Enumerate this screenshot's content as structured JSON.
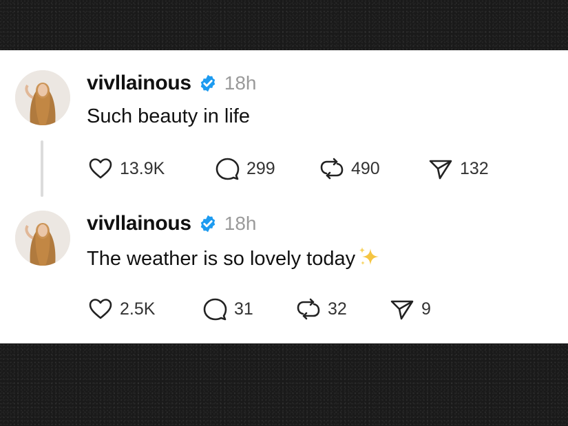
{
  "colors": {
    "verified_badge": "#1d9bf0",
    "timestamp": "#9a9a9a",
    "text": "#111111",
    "sparkle": "#f5c542"
  },
  "posts": [
    {
      "username": "vivllainous",
      "time": "18h",
      "text": "Such beauty in life",
      "emoji": "",
      "likes": "13.9K",
      "replies": "299",
      "reposts": "490",
      "shares": "132"
    },
    {
      "username": "vivllainous",
      "time": "18h",
      "text": "The weather is so lovely today",
      "emoji": "sparkles-icon",
      "likes": "2.5K",
      "replies": "31",
      "reposts": "32",
      "shares": "9"
    }
  ],
  "icons": {
    "like": "heart-icon",
    "reply": "comment-bubble-icon",
    "repost": "repost-icon",
    "share": "send-icon",
    "verified": "verified-badge-icon"
  }
}
